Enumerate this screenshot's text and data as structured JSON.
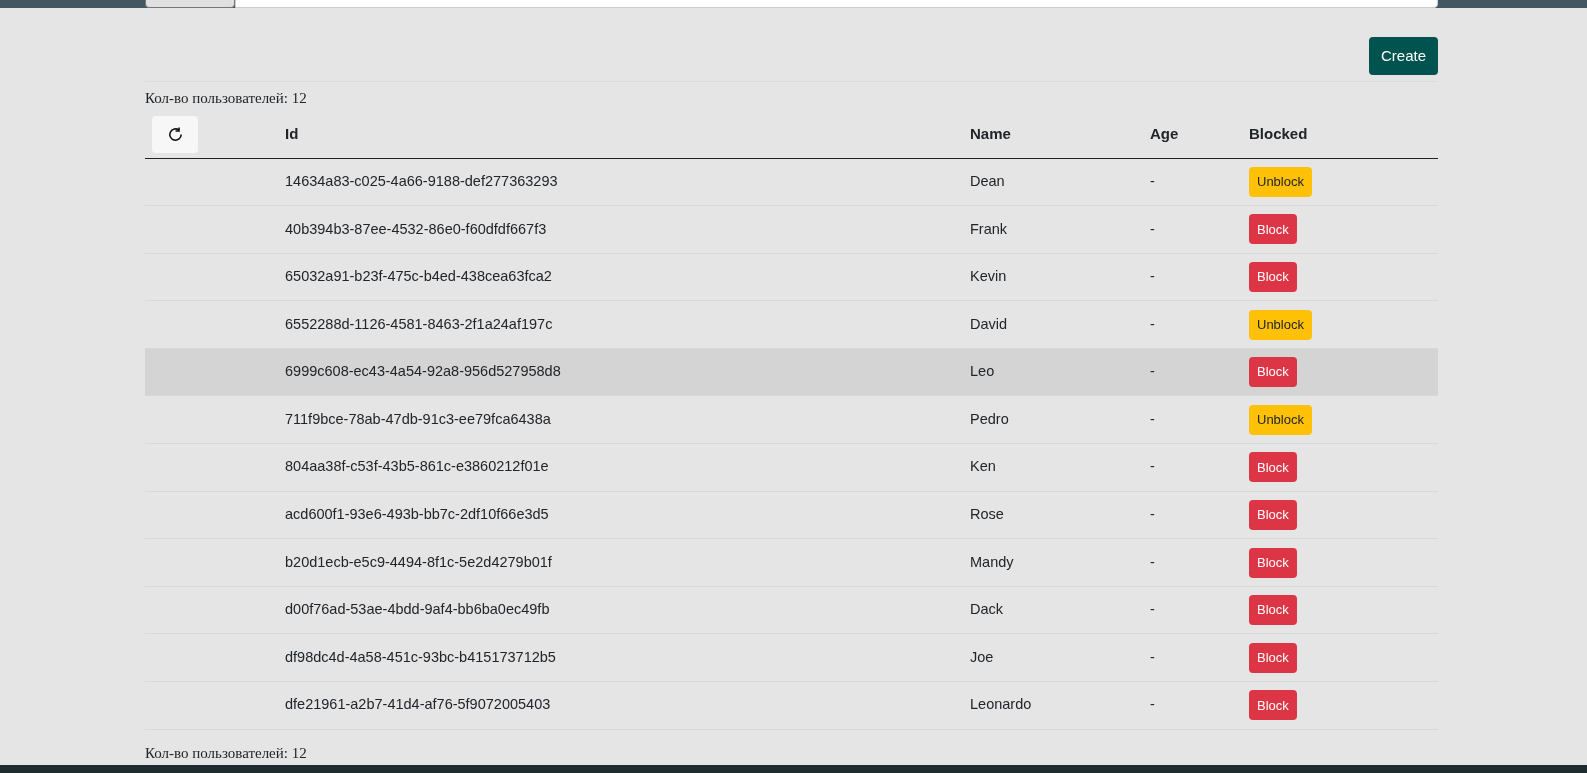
{
  "toolbar": {
    "create_button": "Create"
  },
  "user_count_top": "Кол-во пользователей: 12",
  "table": {
    "columns": [
      "Id",
      "Name",
      "Age",
      "Blocked"
    ],
    "rows": [
      {
        "id": "14634a83-c025-4a66-9188-def277363293",
        "name": "Dean",
        "age": "-",
        "blocked": true,
        "action": "Unblock",
        "selected": false
      },
      {
        "id": "40b394b3-87ee-4532-86e0-f60dfdf667f3",
        "name": "Frank",
        "age": "-",
        "blocked": false,
        "action": "Block",
        "selected": false
      },
      {
        "id": "65032a91-b23f-475c-b4ed-438cea63fca2",
        "name": "Kevin",
        "age": "-",
        "blocked": false,
        "action": "Block",
        "selected": false
      },
      {
        "id": "6552288d-1126-4581-8463-2f1a24af197c",
        "name": "David",
        "age": "-",
        "blocked": true,
        "action": "Unblock",
        "selected": false
      },
      {
        "id": "6999c608-ec43-4a54-92a8-956d527958d8",
        "name": "Leo",
        "age": "-",
        "blocked": false,
        "action": "Block",
        "selected": true
      },
      {
        "id": "711f9bce-78ab-47db-91c3-ee79fca6438a",
        "name": "Pedro",
        "age": "-",
        "blocked": true,
        "action": "Unblock",
        "selected": false
      },
      {
        "id": "804aa38f-c53f-43b5-861c-e3860212f01e",
        "name": "Ken",
        "age": "-",
        "blocked": false,
        "action": "Block",
        "selected": false
      },
      {
        "id": "acd600f1-93e6-493b-bb7c-2df10f66e3d5",
        "name": "Rose",
        "age": "-",
        "blocked": false,
        "action": "Block",
        "selected": false
      },
      {
        "id": "b20d1ecb-e5c9-4494-8f1c-5e2d4279b01f",
        "name": "Mandy",
        "age": "-",
        "blocked": false,
        "action": "Block",
        "selected": false
      },
      {
        "id": "d00f76ad-53ae-4bdd-9af4-bb6ba0ec49fb",
        "name": "Dack",
        "age": "-",
        "blocked": false,
        "action": "Block",
        "selected": false
      },
      {
        "id": "df98dc4d-4a58-451c-93bc-b415173712b5",
        "name": "Joe",
        "age": "-",
        "blocked": false,
        "action": "Block",
        "selected": false
      },
      {
        "id": "dfe21961-a2b7-41d4-af76-5f9072005403",
        "name": "Leonardo",
        "age": "-",
        "blocked": false,
        "action": "Block",
        "selected": false
      }
    ]
  },
  "user_count_bottom": "Кол-во пользователей: 12"
}
